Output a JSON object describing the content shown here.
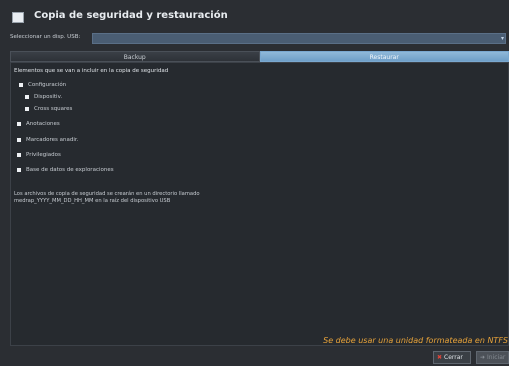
{
  "window": {
    "title": "Copia de seguridad y restauración"
  },
  "device": {
    "label": "Seleccionar un disp. USB:",
    "value": ""
  },
  "tabs": [
    {
      "label": "Backup"
    },
    {
      "label": "Restaurar"
    }
  ],
  "panel": {
    "heading": "Elementos que se van a incluir en la copia de seguridad",
    "options": [
      {
        "label": "Configuración"
      },
      {
        "label": "Dispositiv."
      },
      {
        "label": "Cross squares"
      },
      {
        "label": "Anotaciones"
      },
      {
        "label": "Marcadores anadir."
      },
      {
        "label": "Privilegiados"
      },
      {
        "label": "Base de datos de exploraciones"
      }
    ],
    "info_line1": "Los archivos de copia de seguridad se crearán en un directorio llamado",
    "info_line2": "medrap_YYYY_MM_DD_HH_MM en la raíz del dispositivo USB",
    "warning": "Se debe usar una unidad formateada en NTFS"
  },
  "buttons": {
    "close": "Cerrar",
    "start": "Iniciar"
  },
  "colors": {
    "background": "#2b2e33",
    "active_tab": "#6f9fc8",
    "warning": "#e8a33a",
    "close_icon": "#e0453a"
  }
}
